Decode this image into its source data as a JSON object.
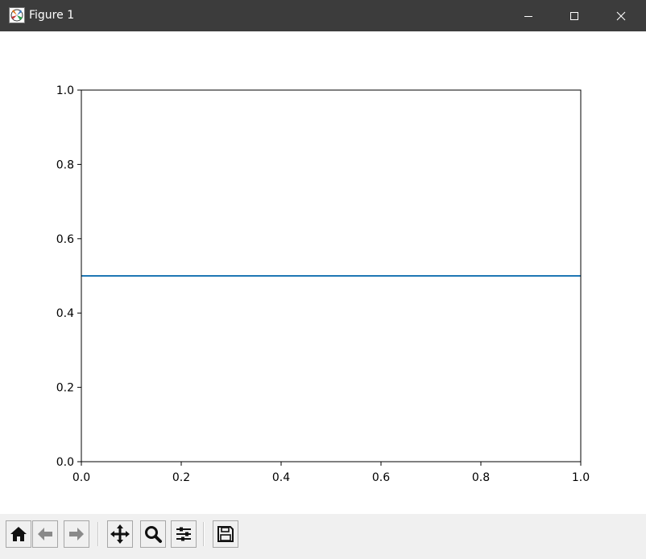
{
  "window": {
    "title": "Figure 1",
    "app_icon": "matplotlib-icon",
    "controls": [
      "minimize-icon",
      "maximize-icon",
      "close-icon"
    ]
  },
  "toolbar": {
    "buttons": [
      {
        "name": "home-button",
        "icon": "home-icon"
      },
      {
        "name": "back-button",
        "icon": "back-arrow-icon"
      },
      {
        "name": "forward-button",
        "icon": "forward-arrow-icon"
      },
      {
        "name": "pan-button",
        "icon": "move-icon"
      },
      {
        "name": "zoom-button",
        "icon": "zoom-icon"
      },
      {
        "name": "configure-subplots-button",
        "icon": "sliders-icon"
      },
      {
        "name": "save-button",
        "icon": "floppy-disk-icon"
      }
    ]
  },
  "chart_data": {
    "type": "line",
    "title": "",
    "xlabel": "",
    "ylabel": "",
    "xlim": [
      0.0,
      1.0
    ],
    "ylim": [
      0.0,
      1.0
    ],
    "x_ticks": [
      "0.0",
      "0.2",
      "0.4",
      "0.6",
      "0.8",
      "1.0"
    ],
    "y_ticks": [
      "0.0",
      "0.2",
      "0.4",
      "0.6",
      "0.8",
      "1.0"
    ],
    "grid": false,
    "series": [
      {
        "x": [
          0.0,
          1.0
        ],
        "y": [
          0.5,
          0.5
        ],
        "color": "#1f77b4"
      }
    ]
  }
}
